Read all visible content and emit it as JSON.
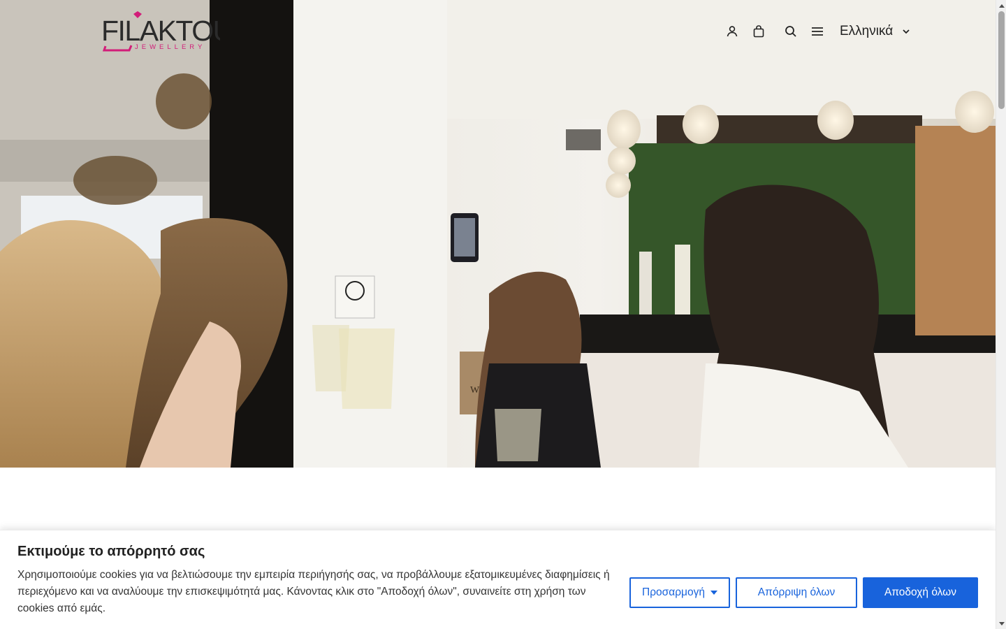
{
  "brand": {
    "name": "FILAKTOU",
    "tagline": "JEWELLERY",
    "accent_color": "#d21d79"
  },
  "header": {
    "icons": [
      "user-icon",
      "shopping-bag-icon",
      "search-icon",
      "menu-icon"
    ],
    "language": "Ελληνικά"
  },
  "hero": {
    "sign_text": "WILLIAM"
  },
  "cookie_banner": {
    "title": "Εκτιμούμε το απόρρητό σας",
    "text": "Χρησιμοποιούμε cookies για να βελτιώσουμε την εμπειρία περιήγησής σας, να προβάλλουμε εξατομικευμένες διαφημίσεις ή περιεχόμενο και να αναλύουμε την επισκεψιμότητά μας. Κάνοντας κλικ στο \"Αποδοχή όλων\", συναινείτε στη χρήση των cookies από εμάς.",
    "customize_label": "Προσαρμογή",
    "reject_label": "Απόρριψη όλων",
    "accept_label": "Αποδοχή όλων",
    "primary_color": "#1863dc"
  }
}
